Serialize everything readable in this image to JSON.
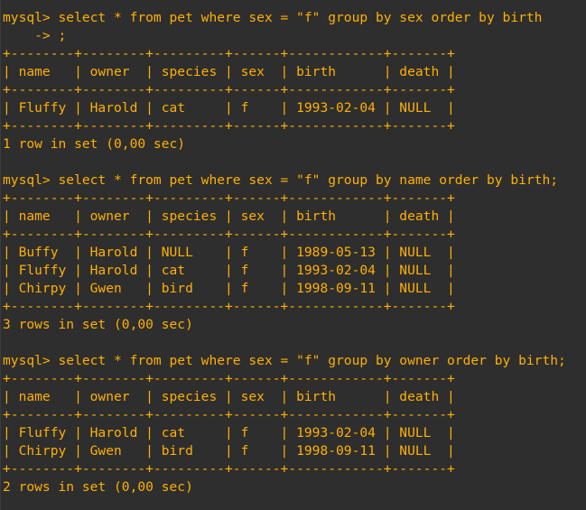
{
  "terminal": {
    "lines": [
      "mysql> select * from pet where sex = \"f\" group by sex order by birth",
      "    -> ;",
      "+--------+--------+---------+------+------------+-------+",
      "| name   | owner  | species | sex  | birth      | death |",
      "+--------+--------+---------+------+------------+-------+",
      "| Fluffy | Harold | cat     | f    | 1993-02-04 | NULL  |",
      "+--------+--------+---------+------+------------+-------+",
      "1 row in set (0,00 sec)",
      "",
      "mysql> select * from pet where sex = \"f\" group by name order by birth;",
      "+--------+--------+---------+------+------------+-------+",
      "| name   | owner  | species | sex  | birth      | death |",
      "+--------+--------+---------+------+------------+-------+",
      "| Buffy  | Harold | NULL    | f    | 1989-05-13 | NULL  |",
      "| Fluffy | Harold | cat     | f    | 1993-02-04 | NULL  |",
      "| Chirpy | Gwen   | bird    | f    | 1998-09-11 | NULL  |",
      "+--------+--------+---------+------+------------+-------+",
      "3 rows in set (0,00 sec)",
      "",
      "mysql> select * from pet where sex = \"f\" group by owner order by birth;",
      "+--------+--------+---------+------+------------+-------+",
      "| name   | owner  | species | sex  | birth      | death |",
      "+--------+--------+---------+------+------------+-------+",
      "| Fluffy | Harold | cat     | f    | 1993-02-04 | NULL  |",
      "| Chirpy | Gwen   | bird    | f    | 1998-09-11 | NULL  |",
      "+--------+--------+---------+------+------------+-------+",
      "2 rows in set (0,00 sec)"
    ]
  }
}
